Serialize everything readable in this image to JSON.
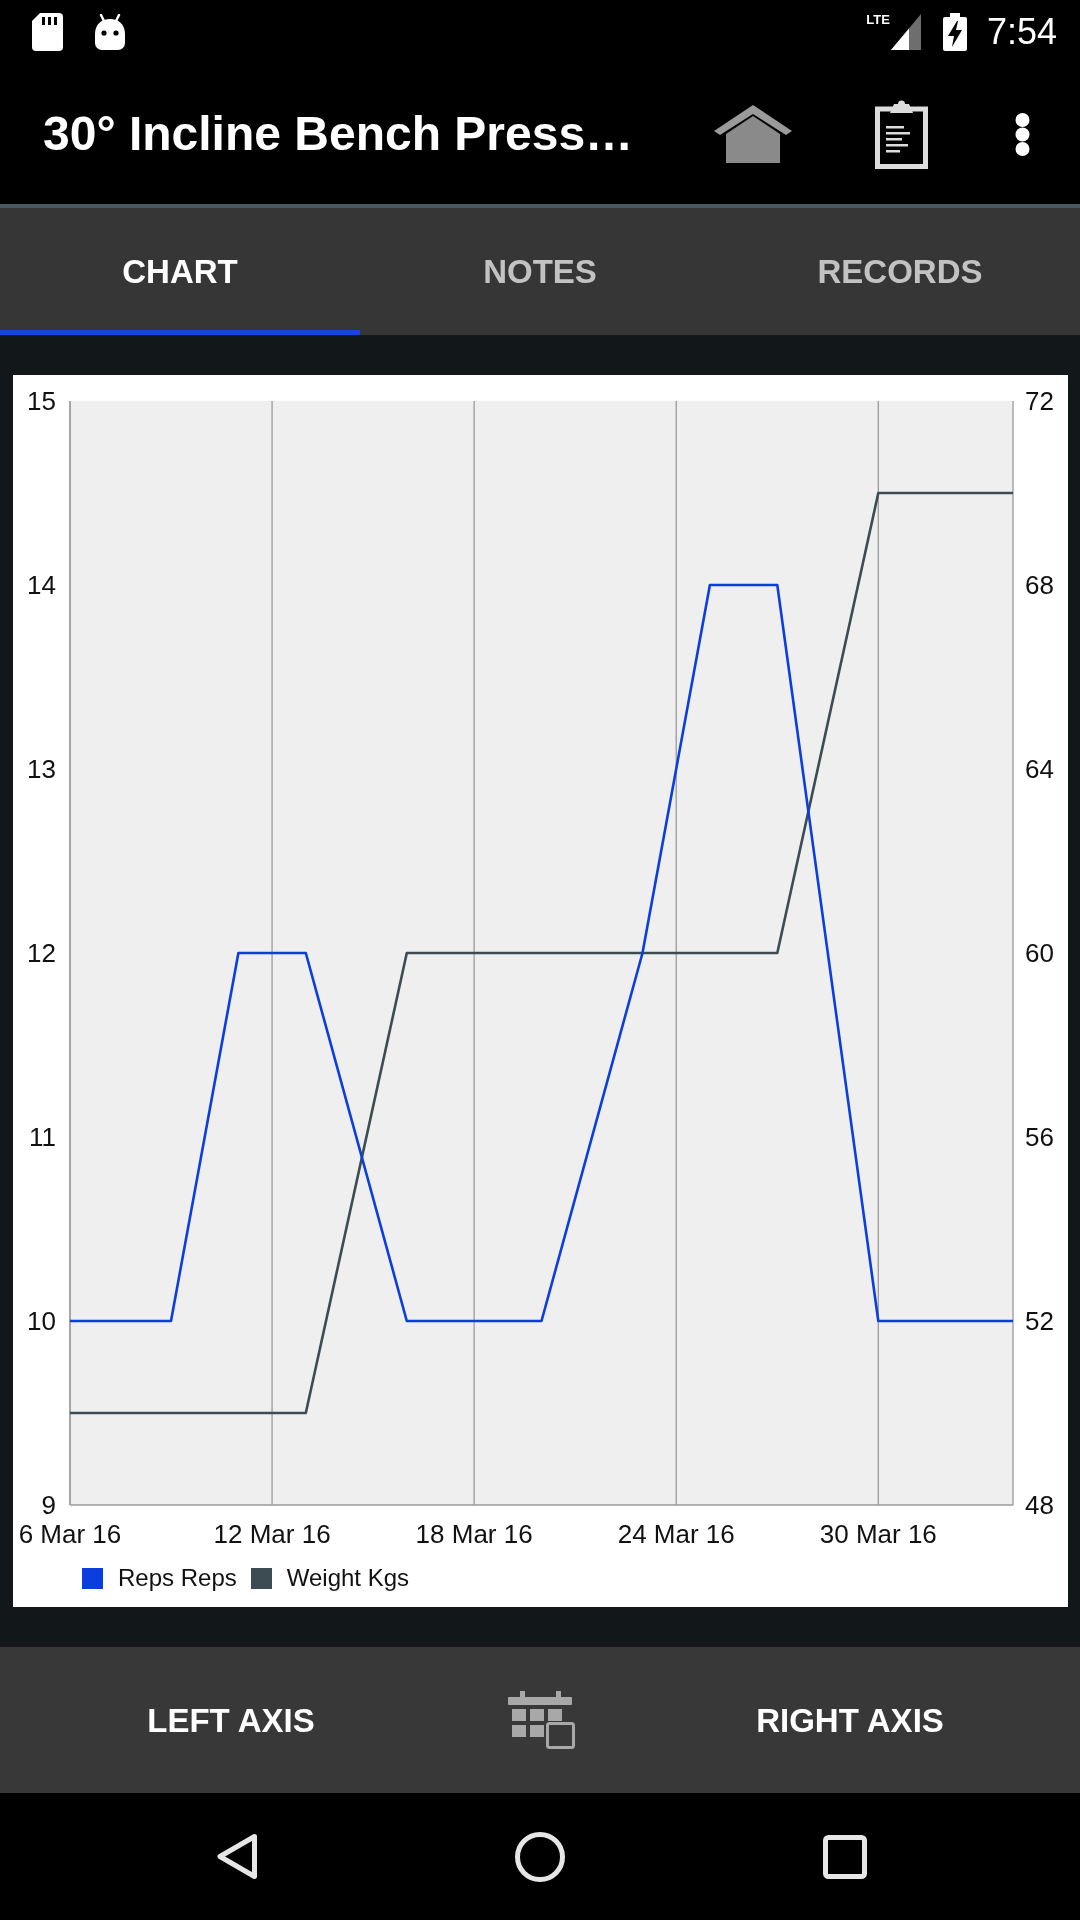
{
  "status_bar": {
    "network": "LTE",
    "time": "7:54"
  },
  "app_bar": {
    "title": "30° Incline Bench Press…"
  },
  "tabs": [
    {
      "label": "CHART",
      "selected": true
    },
    {
      "label": "NOTES",
      "selected": false
    },
    {
      "label": "RECORDS",
      "selected": false
    }
  ],
  "chart": {
    "chart_data": {
      "type": "line",
      "x": [
        "--03-06",
        "--03-09",
        "--03-11",
        "--03-13",
        "--03-16",
        "--03-20",
        "--03-23",
        "--03-25",
        "--03-27",
        "--03-30",
        "--04-03"
      ],
      "xlim": [
        "--03-06",
        "--04-03"
      ],
      "xticks": [
        {
          "value": "--03-06",
          "label": "6 Mar 16"
        },
        {
          "value": "--03-12",
          "label": "12 Mar 16"
        },
        {
          "value": "--03-18",
          "label": "18 Mar 16"
        },
        {
          "value": "--03-24",
          "label": "24 Mar 16"
        },
        {
          "value": "--03-30",
          "label": "30 Mar 16"
        }
      ],
      "ylim": [
        9,
        15
      ],
      "yticks": [
        9,
        10,
        11,
        12,
        13,
        14,
        15
      ],
      "y2lim": [
        48,
        72
      ],
      "y2ticks": [
        48,
        52,
        56,
        60,
        64,
        68,
        72
      ],
      "grid": "x",
      "legend": "bottom-left",
      "series": [
        {
          "name": "Reps Reps",
          "color": "#0b3edc",
          "values": [
            10,
            10,
            12,
            12,
            10,
            10,
            12,
            14,
            14,
            10,
            10
          ]
        },
        {
          "name": "Weight Kgs",
          "color": "#3d4c53",
          "axis": "y2",
          "values": [
            50,
            50,
            50,
            50,
            60,
            60,
            60,
            60,
            60,
            70,
            70
          ]
        }
      ]
    }
  },
  "bottom_bar": {
    "left_button": "LEFT AXIS",
    "right_button": "RIGHT AXIS"
  }
}
